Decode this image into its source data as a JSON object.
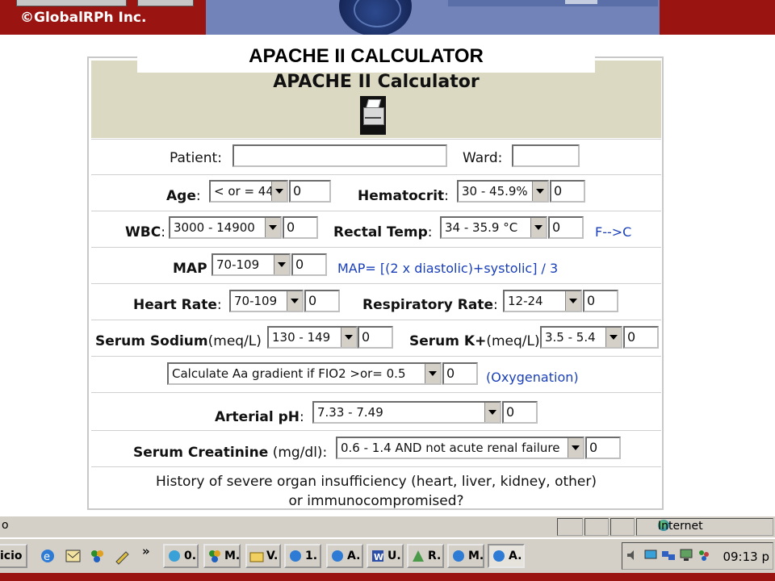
{
  "banner": {
    "copyright": "©GlobalRPh Inc."
  },
  "overlay_title": "APACHE II CALCULATOR",
  "calculator": {
    "header": "APACHE II Calculator",
    "patient_label": "Patient:",
    "ward_label": "Ward:",
    "patient_value": "",
    "ward_value": "",
    "age_label": "Age",
    "age_select": "< or = 44",
    "age_value": "0",
    "hematocrit_label": "Hematocrit",
    "hematocrit_select": "30 - 45.9%",
    "hematocrit_value": "0",
    "wbc_label": "WBC",
    "wbc_select": "3000 - 14900",
    "wbc_value": "0",
    "rectal_label": "Rectal Temp",
    "rectal_select": "34 - 35.9 °C",
    "rectal_value": "0",
    "fc_link": "F-->C",
    "map_label": "MAP",
    "map_select": "70-109",
    "map_value": "0",
    "map_formula": "MAP= [(2 x diastolic)+systolic] / 3",
    "hr_label": "Heart Rate",
    "hr_select": "70-109",
    "hr_value": "0",
    "rr_label": "Respiratory Rate",
    "rr_select": "12-24",
    "rr_value": "0",
    "na_label": "Serum Sodium",
    "na_unit": "(meq/L)",
    "na_select": "130 - 149",
    "na_value": "0",
    "k_label": "Serum K+",
    "k_unit": "(meq/L)",
    "k_select": "3.5 - 5.4",
    "k_value": "0",
    "aa_select": "Calculate Aa gradient if FIO2 >or= 0.5",
    "aa_value": "0",
    "oxy_label": "(Oxygenation)",
    "ph_label": "Arterial pH",
    "ph_select": "7.33 - 7.49",
    "ph_value": "0",
    "creat_label": "Serum Creatinine",
    "creat_unit": "(mg/dl):",
    "creat_select": "0.6 - 1.4  AND not acute renal failure",
    "creat_value": "0",
    "history_line1": "History of severe organ insufficiency (heart, liver, kidney, other)",
    "history_line2": "or immunocompromised?"
  },
  "statusbar": {
    "left_text": "o",
    "zone": "Internet"
  },
  "taskbar": {
    "start_label": "icio",
    "chevron": "»",
    "buttons": [
      "0.",
      "M.",
      "V.",
      "1.",
      "A.",
      "U.",
      "R.",
      "M.",
      "A."
    ],
    "clock": "09:13 p"
  },
  "colors": {
    "banner_red": "#9a1411",
    "banner_blue": "#7183b8",
    "header_beige": "#dcd9c2",
    "link_blue": "#1a3fb8"
  }
}
